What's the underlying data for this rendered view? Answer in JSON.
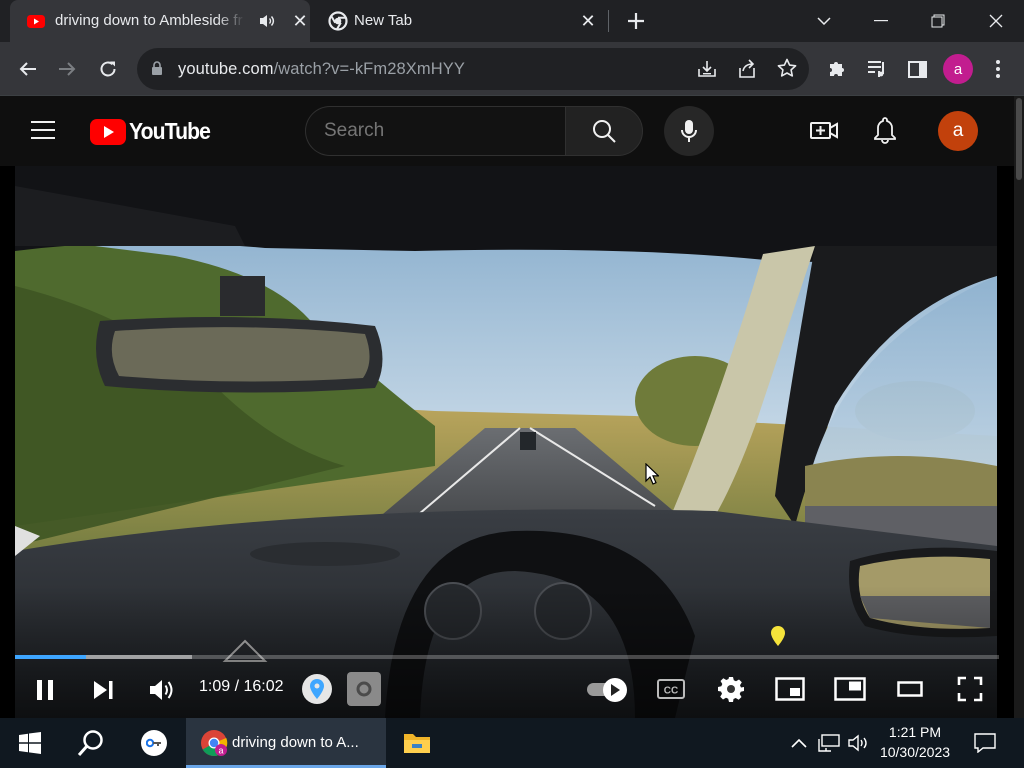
{
  "browser": {
    "tabs": [
      {
        "title": "driving down to Ambleside fr",
        "favicon": "youtube-icon",
        "active": true,
        "audio_playing": true
      },
      {
        "title": "New Tab",
        "favicon": "chrome-icon",
        "active": false
      }
    ],
    "url_host": "youtube.com",
    "url_path": "/watch?v=-kFm28XmHYY",
    "profile_initial": "a"
  },
  "youtube": {
    "logo_text": "YouTube",
    "search_placeholder": "Search",
    "avatar_initial": "a",
    "colors": {
      "logo_red": "#ff0000",
      "avatar": "#c2410c"
    }
  },
  "player": {
    "time_display": "1:09 / 16:02",
    "progress_fraction": 0.072,
    "buffered_fraction": 0.18,
    "autoplay_on": true,
    "playing": true
  },
  "taskbar": {
    "active_window_label": "driving down to A...",
    "time": "1:21 PM",
    "date": "10/30/2023"
  }
}
